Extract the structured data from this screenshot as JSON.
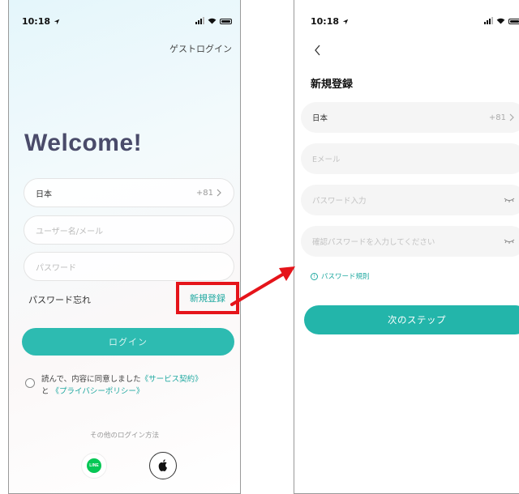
{
  "left_screen": {
    "status_time": "10:18",
    "guest_login": "ゲストログイン",
    "welcome": "Welcome!",
    "country": {
      "name": "日本",
      "code": "+81"
    },
    "username_placeholder": "ユーザー名/メール",
    "password_placeholder": "パスワード",
    "forgot_password": "パスワード忘れ",
    "register_link": "新規登録",
    "login_button": "ログイン",
    "agreement": {
      "prefix": "読んで、内容に同意しました",
      "service_link": "《サービス契約》",
      "and": "と",
      "privacy_link": "《プライバシーポリシー》"
    },
    "other_login_methods": "その他のログイン方法",
    "line_logo_text": "LINE"
  },
  "right_screen": {
    "status_time": "10:18",
    "title": "新規登録",
    "country": {
      "name": "日本",
      "code": "+81"
    },
    "email_placeholder": "Eメール",
    "password_placeholder": "パスワード入力",
    "confirm_password_placeholder": "確認パスワードを入力してください",
    "password_rules": "パスワード規則",
    "next_button": "次のステップ"
  },
  "icons": {
    "location_arrow": "location-arrow-icon",
    "signal": "signal-icon",
    "wifi": "wifi-icon",
    "battery": "battery-icon",
    "chevron": "chevron-right-icon",
    "back": "chevron-left-icon",
    "eye_closed": "eye-closed-icon",
    "info": "info-icon",
    "line": "line-icon",
    "apple": "apple-icon"
  },
  "colors": {
    "accent": "#2dbbb1",
    "highlight": "#e5141a",
    "welcome_text": "#4a4b6a"
  }
}
